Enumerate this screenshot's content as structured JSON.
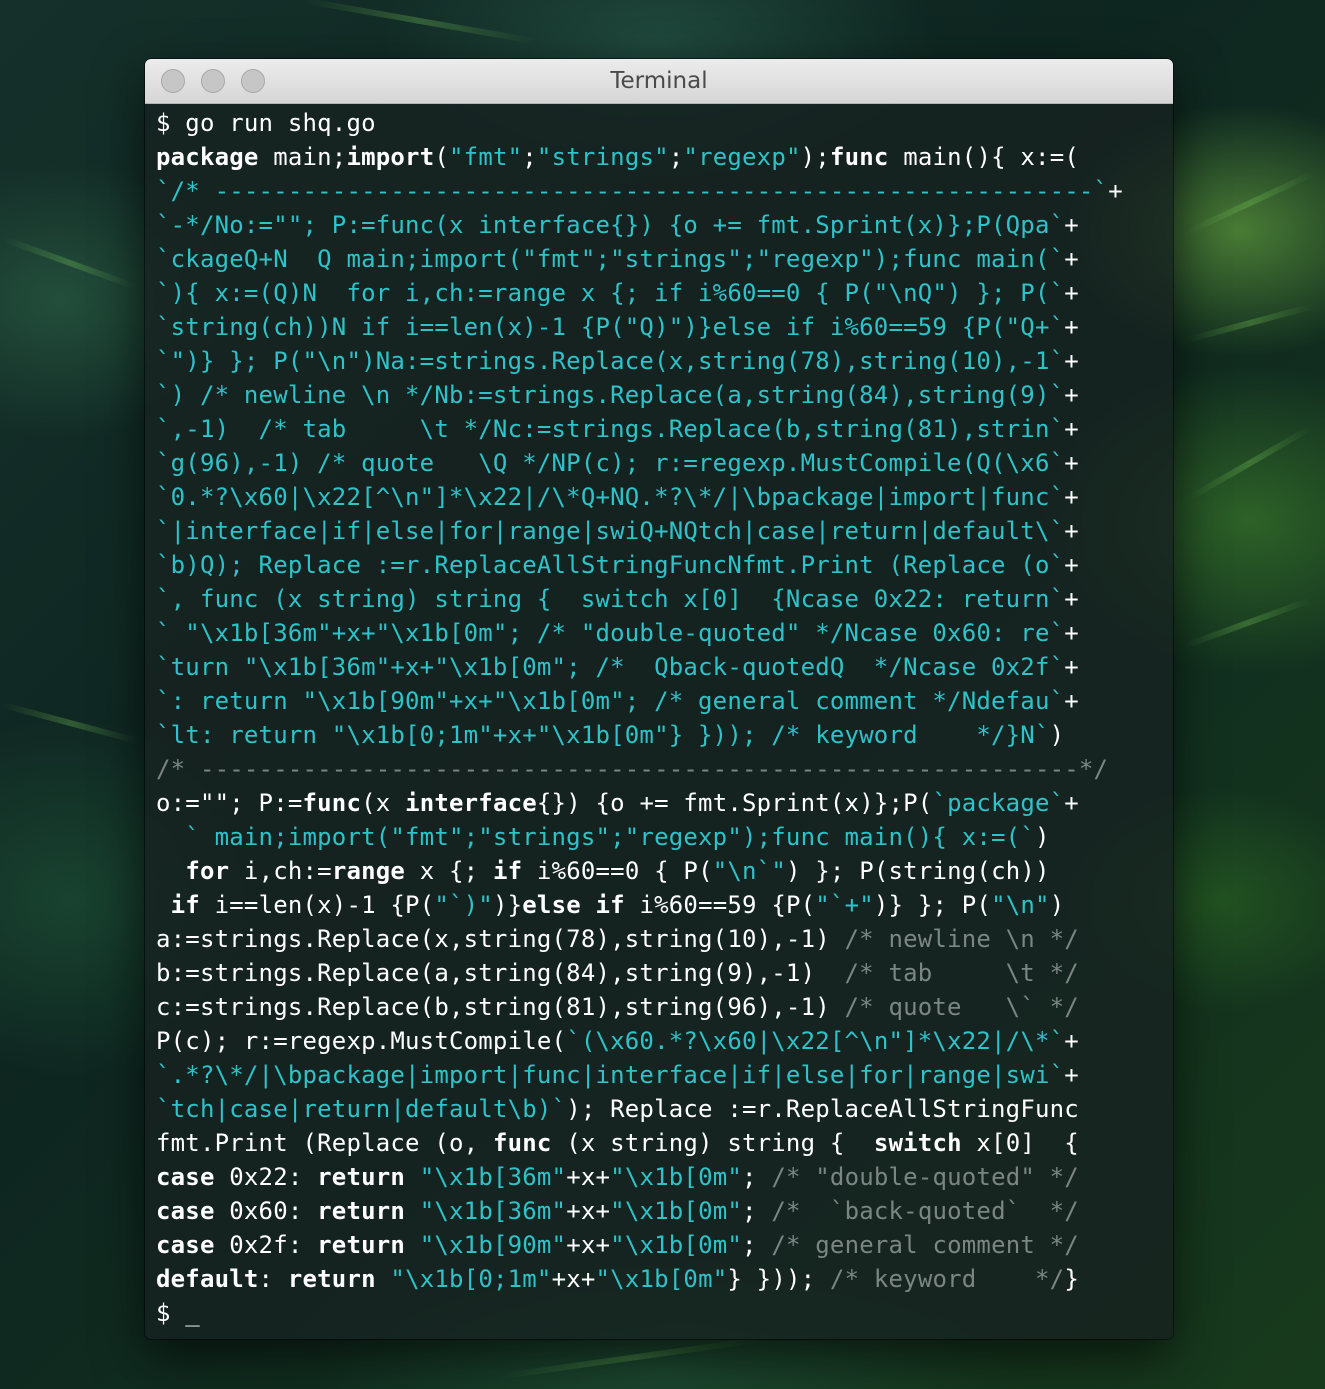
{
  "window": {
    "title": "Terminal",
    "traffic_lights": [
      "close",
      "minimize",
      "zoom"
    ]
  },
  "colors": {
    "plain": "#ffffff",
    "string_cyan": "#2ec2c9",
    "comment_gray": "#7b8683",
    "titlebar": "#e0e0e0",
    "terminal_bg": "#162220"
  },
  "terminal": {
    "lines": [
      [
        [
          "w",
          "$ go run shq.go"
        ]
      ],
      [
        [
          "b",
          "package"
        ],
        [
          "w",
          " main;"
        ],
        [
          "b",
          "import"
        ],
        [
          "w",
          "("
        ],
        [
          "c",
          "\"fmt\""
        ],
        [
          "w",
          ";"
        ],
        [
          "c",
          "\"strings\""
        ],
        [
          "w",
          ";"
        ],
        [
          "c",
          "\"regexp\""
        ],
        [
          "w",
          ");"
        ],
        [
          "b",
          "func"
        ],
        [
          "w",
          " main(){ x:=("
        ]
      ],
      [
        [
          "c",
          "`/* ------------------------------------------------------------`"
        ],
        [
          "w",
          "+"
        ]
      ],
      [
        [
          "c",
          "`-*/No:=\"\"; P:=func(x interface{}) {o += fmt.Sprint(x)};P(Qpa`"
        ],
        [
          "w",
          "+"
        ]
      ],
      [
        [
          "c",
          "`ckageQ+N  Q main;import(\"fmt\";\"strings\";\"regexp\");func main(`"
        ],
        [
          "w",
          "+"
        ]
      ],
      [
        [
          "c",
          "`){ x:=(Q)N  for i,ch:=range x {; if i%60==0 { P(\"\\nQ\") }; P(`"
        ],
        [
          "w",
          "+"
        ]
      ],
      [
        [
          "c",
          "`string(ch))N if i==len(x)-1 {P(\"Q)\")}else if i%60==59 {P(\"Q+`"
        ],
        [
          "w",
          "+"
        ]
      ],
      [
        [
          "c",
          "`\")} }; P(\"\\n\")Na:=strings.Replace(x,string(78),string(10),-1`"
        ],
        [
          "w",
          "+"
        ]
      ],
      [
        [
          "c",
          "`) /* newline \\n */Nb:=strings.Replace(a,string(84),string(9)`"
        ],
        [
          "w",
          "+"
        ]
      ],
      [
        [
          "c",
          "`,-1)  /* tab     \\t */Nc:=strings.Replace(b,string(81),strin`"
        ],
        [
          "w",
          "+"
        ]
      ],
      [
        [
          "c",
          "`g(96),-1) /* quote   \\Q */NP(c); r:=regexp.MustCompile(Q(\\x6`"
        ],
        [
          "w",
          "+"
        ]
      ],
      [
        [
          "c",
          "`0.*?\\x60|\\x22[^\\n\"]*\\x22|/\\*Q+NQ.*?\\*/|\\bpackage|import|func`"
        ],
        [
          "w",
          "+"
        ]
      ],
      [
        [
          "c",
          "`|interface|if|else|for|range|swiQ+NQtch|case|return|default\\`"
        ],
        [
          "w",
          "+"
        ]
      ],
      [
        [
          "c",
          "`b)Q); Replace :=r.ReplaceAllStringFuncNfmt.Print (Replace (o`"
        ],
        [
          "w",
          "+"
        ]
      ],
      [
        [
          "c",
          "`, func (x string) string {  switch x[0]  {Ncase 0x22: return`"
        ],
        [
          "w",
          "+"
        ]
      ],
      [
        [
          "c",
          "` \"\\x1b[36m\"+x+\"\\x1b[0m\"; /* \"double-quoted\" */Ncase 0x60: re`"
        ],
        [
          "w",
          "+"
        ]
      ],
      [
        [
          "c",
          "`turn \"\\x1b[36m\"+x+\"\\x1b[0m\"; /*  Qback-quotedQ  */Ncase 0x2f`"
        ],
        [
          "w",
          "+"
        ]
      ],
      [
        [
          "c",
          "`: return \"\\x1b[90m\"+x+\"\\x1b[0m\"; /* general comment */Ndefau`"
        ],
        [
          "w",
          "+"
        ]
      ],
      [
        [
          "c",
          "`lt: return \"\\x1b[0;1m\"+x+\"\\x1b[0m\"} })); /* keyword    */}N`"
        ],
        [
          "w",
          ")"
        ]
      ],
      [
        [
          "g",
          "/* ------------------------------------------------------------*/"
        ]
      ],
      [
        [
          "w",
          "o:=\"\"; P:="
        ],
        [
          "b",
          "func"
        ],
        [
          "w",
          "(x "
        ],
        [
          "b",
          "interface"
        ],
        [
          "w",
          "{}) {o += fmt.Sprint(x)};P("
        ],
        [
          "c",
          "`package`"
        ],
        [
          "w",
          "+"
        ]
      ],
      [
        [
          "c",
          "  ` main;import(\"fmt\";\"strings\";\"regexp\");func main(){ x:=(`"
        ],
        [
          "w",
          ")"
        ]
      ],
      [
        [
          "w",
          "  "
        ],
        [
          "b",
          "for"
        ],
        [
          "w",
          " i,ch:="
        ],
        [
          "b",
          "range"
        ],
        [
          "w",
          " x {; "
        ],
        [
          "b",
          "if"
        ],
        [
          "w",
          " i%60==0 { P("
        ],
        [
          "c",
          "\"\\n`\""
        ],
        [
          "w",
          ") }; P(string(ch))"
        ]
      ],
      [
        [
          "w",
          " "
        ],
        [
          "b",
          "if"
        ],
        [
          "w",
          " i==len(x)-1 {P("
        ],
        [
          "c",
          "\"`)\""
        ],
        [
          "w",
          ")}"
        ],
        [
          "b",
          "else if"
        ],
        [
          "w",
          " i%60==59 {P("
        ],
        [
          "c",
          "\"`+\""
        ],
        [
          "w",
          ")} }; P("
        ],
        [
          "c",
          "\"\\n\""
        ],
        [
          "w",
          ")"
        ]
      ],
      [
        [
          "w",
          "a:=strings.Replace(x,string(78),string(10),-1) "
        ],
        [
          "g",
          "/* newline \\n */"
        ]
      ],
      [
        [
          "w",
          "b:=strings.Replace(a,string(84),string(9),-1)  "
        ],
        [
          "g",
          "/* tab     \\t */"
        ]
      ],
      [
        [
          "w",
          "c:=strings.Replace(b,string(81),string(96),-1) "
        ],
        [
          "g",
          "/* quote   \\` */"
        ]
      ],
      [
        [
          "w",
          "P(c); r:=regexp.MustCompile("
        ],
        [
          "c",
          "`(\\x60.*?\\x60|\\x22[^\\n\"]*\\x22|/\\*`"
        ],
        [
          "w",
          "+"
        ]
      ],
      [
        [
          "c",
          "`.*?\\*/|\\bpackage|import|func|interface|if|else|for|range|swi`"
        ],
        [
          "w",
          "+"
        ]
      ],
      [
        [
          "c",
          "`tch|case|return|default\\b)`"
        ],
        [
          "w",
          "); Replace :=r.ReplaceAllStringFunc"
        ]
      ],
      [
        [
          "w",
          "fmt.Print (Replace (o, "
        ],
        [
          "b",
          "func"
        ],
        [
          "w",
          " (x string) string {  "
        ],
        [
          "b",
          "switch"
        ],
        [
          "w",
          " x[0]  {"
        ]
      ],
      [
        [
          "b",
          "case"
        ],
        [
          "w",
          " 0x22: "
        ],
        [
          "b",
          "return"
        ],
        [
          "w",
          " "
        ],
        [
          "c",
          "\"\\x1b[36m\""
        ],
        [
          "w",
          "+x+"
        ],
        [
          "c",
          "\"\\x1b[0m\""
        ],
        [
          "w",
          "; "
        ],
        [
          "g",
          "/* \"double-quoted\" */"
        ]
      ],
      [
        [
          "b",
          "case"
        ],
        [
          "w",
          " 0x60: "
        ],
        [
          "b",
          "return"
        ],
        [
          "w",
          " "
        ],
        [
          "c",
          "\"\\x1b[36m\""
        ],
        [
          "w",
          "+x+"
        ],
        [
          "c",
          "\"\\x1b[0m\""
        ],
        [
          "w",
          "; "
        ],
        [
          "g",
          "/*  `back-quoted`  */"
        ]
      ],
      [
        [
          "b",
          "case"
        ],
        [
          "w",
          " 0x2f: "
        ],
        [
          "b",
          "return"
        ],
        [
          "w",
          " "
        ],
        [
          "c",
          "\"\\x1b[90m\""
        ],
        [
          "w",
          "+x+"
        ],
        [
          "c",
          "\"\\x1b[0m\""
        ],
        [
          "w",
          "; "
        ],
        [
          "g",
          "/* general comment */"
        ]
      ],
      [
        [
          "b",
          "default"
        ],
        [
          "w",
          ": "
        ],
        [
          "b",
          "return"
        ],
        [
          "w",
          " "
        ],
        [
          "c",
          "\"\\x1b[0;1m\""
        ],
        [
          "w",
          "+x+"
        ],
        [
          "c",
          "\"\\x1b[0m\""
        ],
        [
          "w",
          "} })); "
        ],
        [
          "g",
          "/* keyword    */"
        ],
        [
          "w",
          "}"
        ]
      ],
      [
        [
          "w",
          "$ _"
        ]
      ]
    ]
  }
}
